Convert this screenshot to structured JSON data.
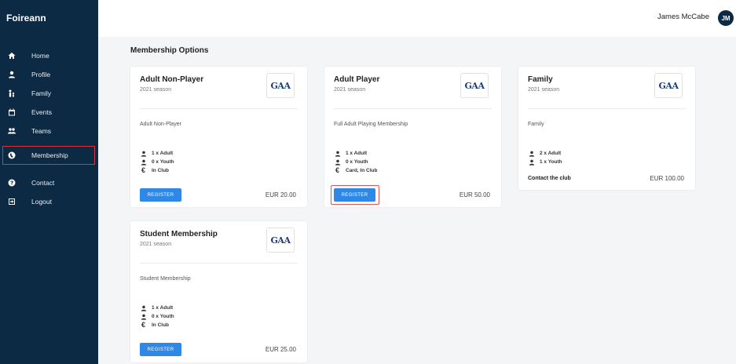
{
  "app": {
    "brand": "Foireann"
  },
  "user": {
    "name": "James McCabe",
    "initials": "JM"
  },
  "sidebar": {
    "items": [
      {
        "label": "Home",
        "icon": "home-icon"
      },
      {
        "label": "Profile",
        "icon": "user-icon"
      },
      {
        "label": "Family",
        "icon": "family-icon"
      },
      {
        "label": "Events",
        "icon": "calendar-icon"
      },
      {
        "label": "Teams",
        "icon": "team-icon"
      },
      {
        "label": "Membership",
        "icon": "globe-icon",
        "active": true
      },
      {
        "label": "Contact",
        "icon": "help-icon"
      },
      {
        "label": "Logout",
        "icon": "logout-icon"
      }
    ]
  },
  "page": {
    "title": "Membership Options"
  },
  "logo_text": "GAA",
  "colors": {
    "sidebar": "#0d2a45",
    "button": "#2f87e6",
    "highlight": "#d9343a"
  },
  "cards": [
    {
      "title": "Adult Non-Player",
      "season": "2021 season",
      "description": "Adult Non-Player",
      "adult": "1 x Adult",
      "youth": "0 x Youth",
      "payment": "In Club",
      "register": "REGISTER",
      "price": "EUR 20.00"
    },
    {
      "title": "Adult Player",
      "season": "2021 season",
      "description": "Full Adult Playing Membership",
      "adult": "1 x Adult",
      "youth": "0 x Youth",
      "payment": "Card, In Club",
      "register": "REGISTER",
      "price": "EUR 50.00"
    },
    {
      "title": "Family",
      "season": "2021 season",
      "description": "Family",
      "adult": "2 x Adult",
      "youth": "1 x Youth",
      "contact": "Contact the club",
      "price": "EUR 100.00"
    },
    {
      "title": "Student Membership",
      "season": "2021 season",
      "description": "Student Membership",
      "adult": "1 x Adult",
      "youth": "0 x Youth",
      "payment": "In Club",
      "register": "REGISTER",
      "price": "EUR 25.00"
    }
  ]
}
